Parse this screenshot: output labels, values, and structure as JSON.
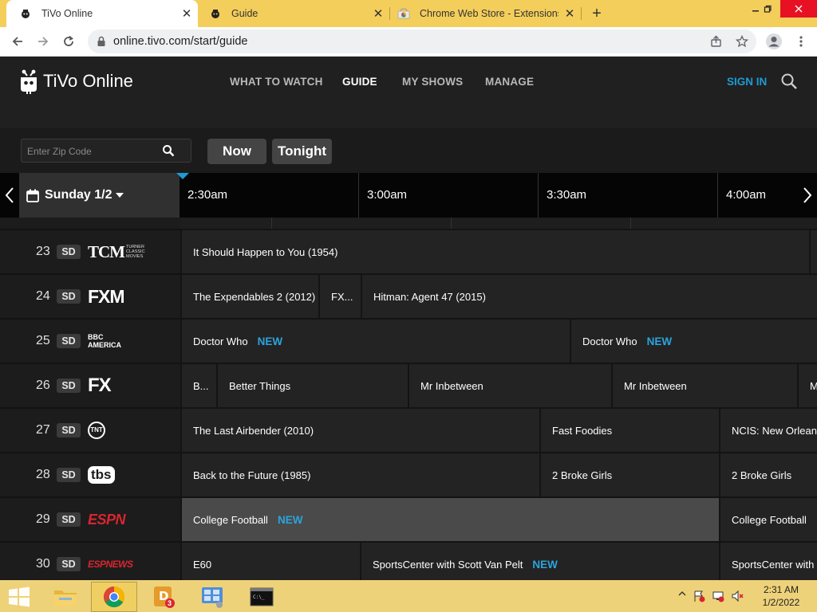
{
  "browser": {
    "tabs": [
      {
        "title": "TiVo Online",
        "favicon": "tivo-icon",
        "active": true
      },
      {
        "title": "Guide",
        "favicon": "tivo-icon",
        "active": false
      },
      {
        "title": "Chrome Web Store - Extensions",
        "favicon": "chrome-web-store-icon",
        "active": false
      }
    ],
    "new_tab_label": "+",
    "url": "online.tivo.com/start/guide"
  },
  "header": {
    "logo_text": "TiVo Online",
    "nav": [
      "WHAT TO WATCH",
      "GUIDE",
      "MY SHOWS",
      "MANAGE"
    ],
    "nav_active": "GUIDE",
    "sign_in": "SIGN IN"
  },
  "controls": {
    "zip_placeholder": "Enter Zip Code",
    "now": "Now",
    "tonight": "Tonight"
  },
  "timebar": {
    "date": "Sunday 1/2",
    "slots": [
      "2:30am",
      "3:00am",
      "3:30am",
      "4:00am"
    ]
  },
  "channels": [
    {
      "number": "23",
      "quality": "SD",
      "network": "TCM",
      "network_sub": "TURNER CLASSIC MOVIES",
      "programs": [
        {
          "title": "It Should Happen to You (1954)",
          "badge": ""
        }
      ]
    },
    {
      "number": "24",
      "quality": "SD",
      "network": "FXM",
      "programs": [
        {
          "title": "The Expendables 2 (2012)",
          "badge": ""
        },
        {
          "title": "FX...",
          "badge": ""
        },
        {
          "title": "Hitman: Agent 47 (2015)",
          "badge": ""
        }
      ]
    },
    {
      "number": "25",
      "quality": "SD",
      "network": "BBC AMERICA",
      "programs": [
        {
          "title": "Doctor Who",
          "badge": "NEW"
        },
        {
          "title": "Doctor Who",
          "badge": "NEW"
        }
      ]
    },
    {
      "number": "26",
      "quality": "SD",
      "network": "FX",
      "programs": [
        {
          "title": "B...",
          "badge": ""
        },
        {
          "title": "Better Things",
          "badge": ""
        },
        {
          "title": "Mr Inbetween",
          "badge": ""
        },
        {
          "title": "Mr Inbetween",
          "badge": ""
        },
        {
          "title": "M",
          "badge": ""
        }
      ]
    },
    {
      "number": "27",
      "quality": "SD",
      "network": "TNT",
      "programs": [
        {
          "title": "The Last Airbender (2010)",
          "badge": ""
        },
        {
          "title": "Fast Foodies",
          "badge": ""
        },
        {
          "title": "NCIS: New Orleans",
          "badge": ""
        }
      ]
    },
    {
      "number": "28",
      "quality": "SD",
      "network": "tbs",
      "programs": [
        {
          "title": "Back to the Future (1985)",
          "badge": ""
        },
        {
          "title": "2 Broke Girls",
          "badge": ""
        },
        {
          "title": "2 Broke Girls",
          "badge": ""
        }
      ]
    },
    {
      "number": "29",
      "quality": "SD",
      "network": "ESPN",
      "programs": [
        {
          "title": "College Football",
          "badge": "NEW"
        },
        {
          "title": "College Football",
          "badge": ""
        }
      ]
    },
    {
      "number": "30",
      "quality": "SD",
      "network": "ESPNEWS",
      "programs": [
        {
          "title": "E60",
          "badge": ""
        },
        {
          "title": "SportsCenter with Scott Van Pelt",
          "badge": "NEW"
        },
        {
          "title": "SportsCenter with",
          "badge": ""
        }
      ]
    }
  ],
  "taskbar": {
    "apps": [
      "file-explorer-icon",
      "chrome-icon",
      "dictionary-icon",
      "control-panel-icon",
      "command-prompt-icon"
    ],
    "dictionary_badge": "3",
    "time": "2:31 AM",
    "date": "1/2/2022"
  },
  "colors": {
    "accent": "#1e9ad6",
    "browser_frame": "#f4ce5b",
    "taskbar": "#eed27a",
    "espn_red": "#d8262f"
  }
}
